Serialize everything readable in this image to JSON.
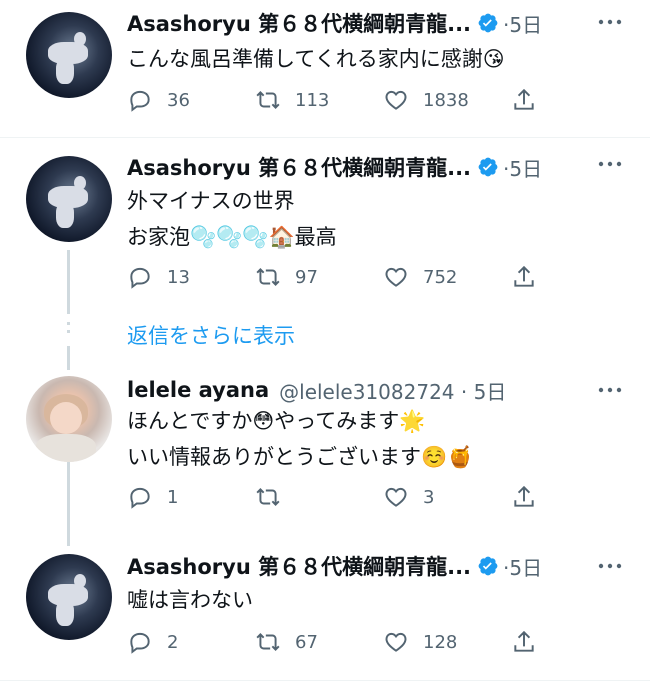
{
  "tweets": [
    {
      "name": "Asashoryu 第６８代横綱朝青龍...",
      "meta": "·5日",
      "lines": [
        "こんな風呂準備してくれる家内に感謝😘"
      ],
      "replies": "36",
      "retweets": "113",
      "likes": "1838"
    },
    {
      "name": "Asashoryu 第６８代横綱朝青龍...",
      "meta": "·5日",
      "lines": [
        "外マイナスの世界",
        "お家泡🫧🫧🫧🏠最高"
      ],
      "replies": "13",
      "retweets": "97",
      "likes": "752"
    },
    {
      "name": "lelele ayana",
      "meta": "@lelele31082724 · 5日",
      "lines": [
        "ほんとですか😳やってみます🌟",
        "いい情報ありがとうございます☺️🍯"
      ],
      "replies": "1",
      "retweets": "",
      "likes": "3"
    },
    {
      "name": "Asashoryu 第６８代横綱朝青龍...",
      "meta": "·5日",
      "lines": [
        "嘘は言わない"
      ],
      "replies": "2",
      "retweets": "67",
      "likes": "128"
    }
  ],
  "show_more_replies": "返信をさらに表示",
  "icons": {
    "more": "more-horizontal-icon",
    "verified": "verified-badge-icon",
    "reply": "reply-icon",
    "retweet": "retweet-icon",
    "like": "heart-icon",
    "share": "share-icon"
  },
  "colors": {
    "accent": "#1d9bf0",
    "text": "#0f1419",
    "secondary": "#536471"
  }
}
